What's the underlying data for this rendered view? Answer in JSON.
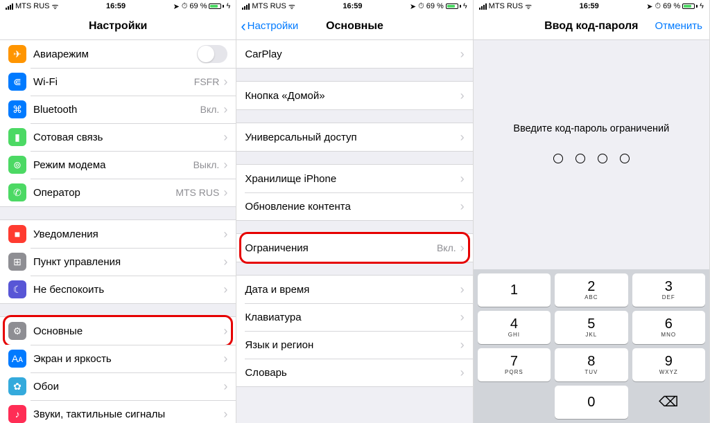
{
  "status": {
    "carrier": "MTS RUS",
    "time": "16:59",
    "battery_pct": "69 %"
  },
  "pane1": {
    "title": "Настройки",
    "groups": [
      [
        {
          "icon": "airplane",
          "label": "Авиарежим",
          "toggle": true
        },
        {
          "icon": "wifi",
          "label": "Wi-Fi",
          "value": "FSFR"
        },
        {
          "icon": "bluetooth",
          "label": "Bluetooth",
          "value": "Вкл."
        },
        {
          "icon": "cellular",
          "label": "Сотовая связь"
        },
        {
          "icon": "hotspot",
          "label": "Режим модема",
          "value": "Выкл."
        },
        {
          "icon": "carrier",
          "label": "Оператор",
          "value": "MTS RUS"
        }
      ],
      [
        {
          "icon": "notifications",
          "label": "Уведомления"
        },
        {
          "icon": "control",
          "label": "Пункт управления"
        },
        {
          "icon": "dnd",
          "label": "Не беспокоить"
        }
      ],
      [
        {
          "icon": "general",
          "label": "Основные",
          "highlight": true
        },
        {
          "icon": "display",
          "label": "Экран и яркость"
        },
        {
          "icon": "wallpaper",
          "label": "Обои"
        },
        {
          "icon": "sounds",
          "label": "Звуки, тактильные сигналы"
        }
      ]
    ]
  },
  "pane2": {
    "back": "Настройки",
    "title": "Основные",
    "groups": [
      [
        {
          "label": "CarPlay"
        }
      ],
      [
        {
          "label": "Кнопка «Домой»"
        }
      ],
      [
        {
          "label": "Универсальный доступ"
        }
      ],
      [
        {
          "label": "Хранилище iPhone"
        },
        {
          "label": "Обновление контента"
        }
      ],
      [
        {
          "label": "Ограничения",
          "value": "Вкл.",
          "highlight": true
        }
      ],
      [
        {
          "label": "Дата и время"
        },
        {
          "label": "Клавиатура"
        },
        {
          "label": "Язык и регион"
        },
        {
          "label": "Словарь"
        }
      ]
    ]
  },
  "pane3": {
    "title": "Ввод код-пароля",
    "cancel": "Отменить",
    "prompt": "Введите код-пароль ограничений",
    "keys": [
      {
        "n": "1",
        "s": ""
      },
      {
        "n": "2",
        "s": "ABC"
      },
      {
        "n": "3",
        "s": "DEF"
      },
      {
        "n": "4",
        "s": "GHI"
      },
      {
        "n": "5",
        "s": "JKL"
      },
      {
        "n": "6",
        "s": "MNO"
      },
      {
        "n": "7",
        "s": "PQRS"
      },
      {
        "n": "8",
        "s": "TUV"
      },
      {
        "n": "9",
        "s": "WXYZ"
      },
      {
        "n": "",
        "s": "",
        "blank": true
      },
      {
        "n": "0",
        "s": ""
      },
      {
        "n": "⌫",
        "s": "",
        "del": true
      }
    ]
  },
  "icons": {
    "airplane": {
      "bg": "#ff9500",
      "glyph": "✈"
    },
    "wifi": {
      "bg": "#007aff",
      "glyph": "⋐"
    },
    "bluetooth": {
      "bg": "#007aff",
      "glyph": "⌘"
    },
    "cellular": {
      "bg": "#4cd964",
      "glyph": "▮"
    },
    "hotspot": {
      "bg": "#4cd964",
      "glyph": "⊚"
    },
    "carrier": {
      "bg": "#4cd964",
      "glyph": "✆"
    },
    "notifications": {
      "bg": "#ff3b30",
      "glyph": "■"
    },
    "control": {
      "bg": "#8e8e93",
      "glyph": "⊞"
    },
    "dnd": {
      "bg": "#5856d6",
      "glyph": "☾"
    },
    "general": {
      "bg": "#8e8e93",
      "glyph": "⚙"
    },
    "display": {
      "bg": "#007aff",
      "glyph": "Aᴀ"
    },
    "wallpaper": {
      "bg": "#34aadc",
      "glyph": "✿"
    },
    "sounds": {
      "bg": "#ff2d55",
      "glyph": "♪"
    }
  }
}
